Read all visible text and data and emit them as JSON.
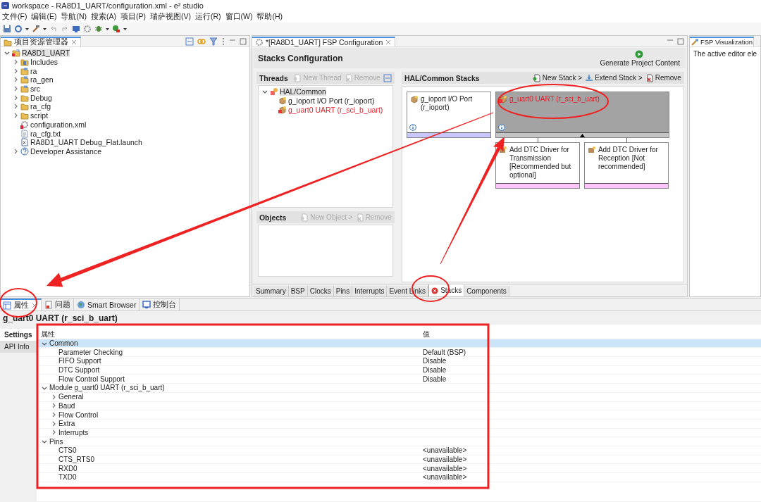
{
  "window": {
    "title": "workspace - RA8D1_UART/configuration.xml - e² studio"
  },
  "menu": [
    "文件(F)",
    "编辑(E)",
    "导航(N)",
    "搜索(A)",
    "项目(P)",
    "瑞萨视图(V)",
    "运行(R)",
    "窗口(W)",
    "帮助(H)"
  ],
  "project_explorer": {
    "title": "项目资源管理器",
    "tree": [
      {
        "label": "RA8D1_UART",
        "kind": "project",
        "expanded": true,
        "selected": true,
        "children": [
          {
            "label": "Includes",
            "kind": "includes",
            "expanded": false,
            "selected": false
          },
          {
            "label": "ra",
            "kind": "source",
            "expanded": false,
            "selected": false
          },
          {
            "label": "ra_gen",
            "kind": "source",
            "expanded": false,
            "selected": false
          },
          {
            "label": "src",
            "kind": "source",
            "expanded": false,
            "selected": false
          },
          {
            "label": "Debug",
            "kind": "folder",
            "expanded": false,
            "selected": false
          },
          {
            "label": "ra_cfg",
            "kind": "folder",
            "expanded": false,
            "selected": false
          },
          {
            "label": "script",
            "kind": "folder",
            "expanded": false,
            "selected": false
          },
          {
            "label": "configuration.xml",
            "kind": "config",
            "selected": false
          },
          {
            "label": "ra_cfg.txt",
            "kind": "text",
            "selected": false
          },
          {
            "label": "RA8D1_UART Debug_Flat.launch",
            "kind": "launch",
            "selected": false
          },
          {
            "label": "Developer Assistance",
            "kind": "help",
            "expanded": false,
            "selected": false
          }
        ]
      }
    ]
  },
  "editor": {
    "tab": "*[RA8D1_UART] FSP Configuration",
    "heading": "Stacks Configuration",
    "generate": "Generate Project Content",
    "threads": {
      "title": "Threads",
      "actions": [
        {
          "label": "New Thread",
          "disabled": true
        },
        {
          "label": "Remove",
          "disabled": true
        }
      ],
      "tree": [
        {
          "label": "HAL/Common",
          "kind": "thread",
          "expanded": true,
          "selected": true,
          "children": [
            {
              "label": "g_ioport I/O Port (r_ioport)",
              "kind": "module",
              "error": false,
              "selected": false
            },
            {
              "label": "g_uart0 UART (r_sci_b_uart)",
              "kind": "module",
              "error": true,
              "selected": false
            }
          ]
        }
      ]
    },
    "objects": {
      "title": "Objects",
      "actions": [
        {
          "label": "New Object >",
          "disabled": true
        },
        {
          "label": "Remove",
          "disabled": true
        }
      ]
    },
    "stacks": {
      "title": "HAL/Common Stacks",
      "actions": [
        {
          "label": "New Stack >",
          "kind": "new",
          "disabled": false
        },
        {
          "label": "Extend Stack >",
          "kind": "extend",
          "disabled": false
        },
        {
          "label": "Remove",
          "kind": "remove",
          "disabled": false
        }
      ],
      "modules": [
        {
          "name": "g_ioport I/O Port (r_ioport)",
          "selected": false,
          "error": false
        },
        {
          "name": "g_uart0 UART (r_sci_b_uart)",
          "selected": true,
          "error": true,
          "children": [
            {
              "name": "Add DTC Driver for Transmission [Recommended but optional]"
            },
            {
              "name": "Add DTC Driver for Reception [Not recommended]"
            }
          ]
        }
      ]
    },
    "tabs": [
      {
        "label": "Summary",
        "selected": false,
        "error": false
      },
      {
        "label": "BSP",
        "selected": false,
        "error": false
      },
      {
        "label": "Clocks",
        "selected": false,
        "error": false
      },
      {
        "label": "Pins",
        "selected": false,
        "error": false
      },
      {
        "label": "Interrupts",
        "selected": false,
        "error": false
      },
      {
        "label": "Event Links",
        "selected": false,
        "error": false
      },
      {
        "label": "Stacks",
        "selected": true,
        "error": true
      },
      {
        "label": "Components",
        "selected": false,
        "error": false
      }
    ]
  },
  "visualization": {
    "title": "FSP Visualization",
    "text": "The active editor ele"
  },
  "bottom": {
    "tabs": [
      {
        "label": "属性",
        "kind": "properties",
        "selected": true
      },
      {
        "label": "问题",
        "kind": "problems",
        "selected": false
      },
      {
        "label": "Smart Browser",
        "kind": "browser",
        "selected": false
      },
      {
        "label": "控制台",
        "kind": "console",
        "selected": false
      }
    ],
    "title": "g_uart0 UART (r_sci_b_uart)",
    "side_tabs": [
      {
        "label": "Settings",
        "selected": true
      },
      {
        "label": "API Info",
        "selected": false
      }
    ],
    "columns": [
      "属性",
      "值"
    ],
    "rows": [
      {
        "name": "Common",
        "expanded": true,
        "selected": true,
        "children": [
          {
            "name": "Parameter Checking",
            "value": "Default (BSP)",
            "selected": false
          },
          {
            "name": "FIFO Support",
            "value": "Disable",
            "selected": false
          },
          {
            "name": "DTC Support",
            "value": "Disable",
            "selected": false
          },
          {
            "name": "Flow Control Support",
            "value": "Disable",
            "selected": false
          }
        ]
      },
      {
        "name": "Module g_uart0 UART (r_sci_b_uart)",
        "expanded": true,
        "selected": false,
        "children": [
          {
            "name": "General",
            "expanded": false,
            "selected": false
          },
          {
            "name": "Baud",
            "expanded": false,
            "selected": false
          },
          {
            "name": "Flow Control",
            "expanded": false,
            "selected": false
          },
          {
            "name": "Extra",
            "expanded": false,
            "selected": false
          },
          {
            "name": "Interrupts",
            "expanded": false,
            "selected": false
          }
        ]
      },
      {
        "name": "Pins",
        "expanded": true,
        "selected": false,
        "children": [
          {
            "name": "CTS0",
            "value": "<unavailable>",
            "selected": false
          },
          {
            "name": "CTS_RTS0",
            "value": "<unavailable>",
            "selected": false
          },
          {
            "name": "RXD0",
            "value": "<unavailable>",
            "selected": false
          },
          {
            "name": "TXD0",
            "value": "<unavailable>",
            "selected": false
          }
        ]
      }
    ]
  }
}
